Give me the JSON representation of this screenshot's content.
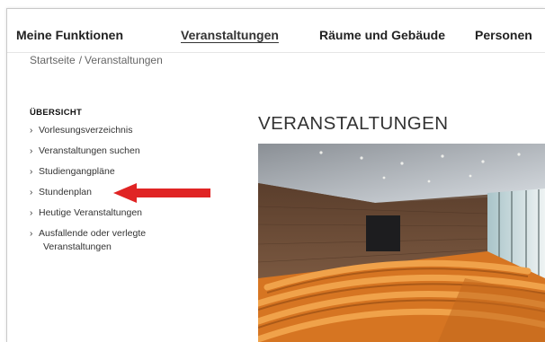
{
  "topnav": {
    "items": [
      {
        "label": "Meine Funktionen"
      },
      {
        "label": "Veranstaltungen"
      },
      {
        "label": "Räume und Gebäude"
      },
      {
        "label": "Personen"
      }
    ],
    "active_index": 1
  },
  "breadcrumb": {
    "home": "Startseite",
    "separator": "/",
    "current": "Veranstaltungen"
  },
  "sidebar": {
    "title": "ÜBERSICHT",
    "items": [
      {
        "label": "Vorlesungsverzeichnis",
        "icon": "chevron-right-icon"
      },
      {
        "label": "Veranstaltungen suchen",
        "icon": "chevron-right-icon"
      },
      {
        "label": "Studiengangpläne",
        "icon": "chevron-right-icon"
      },
      {
        "label": "Stundenplan",
        "icon": "chevron-right-icon"
      },
      {
        "label": "Heutige Veranstaltungen",
        "icon": "chevron-right-icon"
      },
      {
        "label": "Ausfallende oder verlegte",
        "icon": "chevron-right-icon"
      }
    ],
    "item_continuation": "Veranstaltungen"
  },
  "annotation": {
    "icon": "red-arrow-left-icon",
    "color": "#e02424"
  },
  "main": {
    "title": "VERANSTALTUNGEN",
    "hero_image": "lecture-hall-photo"
  },
  "colors": {
    "seat": "#e8892a",
    "wood_wall": "#6b4a34",
    "accent_arrow": "#e02424"
  }
}
